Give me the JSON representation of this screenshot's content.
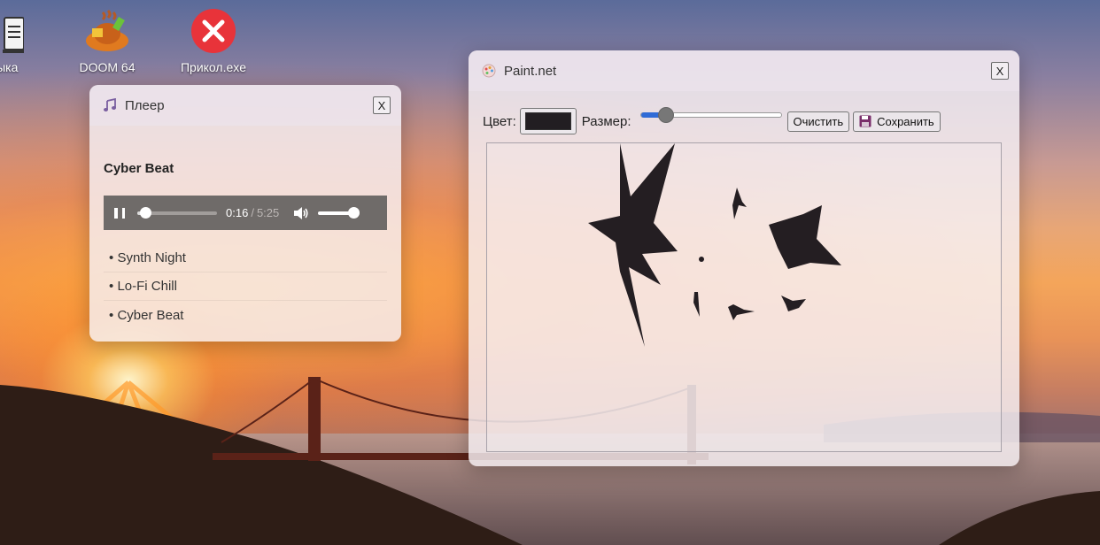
{
  "desktop": {
    "icons": [
      {
        "label": "ызыка",
        "icon": "music-folder-icon"
      },
      {
        "label": "DOOM 64",
        "icon": "doom-icon"
      },
      {
        "label": "Прикол.exe",
        "icon": "error-x-icon"
      }
    ]
  },
  "player": {
    "title": "Плеер",
    "close_label": "X",
    "now_playing": "Cyber Beat",
    "current_time": "0:16",
    "separator": "/",
    "total_time": "5:25",
    "progress": 0.05,
    "volume": 1.0,
    "playlist": [
      "Synth Night",
      "Lo-Fi Chill",
      "Cyber Beat"
    ],
    "bullet": "•"
  },
  "paint": {
    "title": "Paint.net",
    "close_label": "X",
    "color_label": "Цвет:",
    "size_label": "Размер:",
    "selected_color": "#221e22",
    "size_value": 0.18,
    "clear_button": "Очистить",
    "save_button": "Сохранить"
  },
  "colors": {
    "accent": "#2f6bd6",
    "player_bar": "#6f6b69",
    "error_red": "#e8333a"
  }
}
